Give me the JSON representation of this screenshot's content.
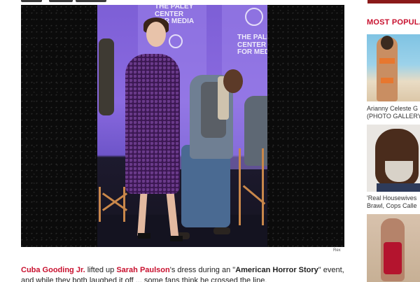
{
  "photo": {
    "credit": "Rex",
    "banner_text_1": "THE PALEY\nCENTER\nFOR MEDIA",
    "banner_text_2": "THE PALEY\nCENTER\nFOR MEDIA"
  },
  "article": {
    "person_1": "Cuba Gooding Jr.",
    "text_1": " lifted up ",
    "person_2": "Sarah Paulson",
    "text_2": "'s dress during an \"",
    "show": "American Horror Story",
    "text_3": "\" event, and while they both laughed it off ... some fans think he crossed the line."
  },
  "sidebar": {
    "heading": "MOST POPULAR",
    "items": [
      {
        "caption_line_1": "Arianny Celeste G",
        "caption_line_2": "(PHOTO GALLERY)"
      },
      {
        "caption_line_1": "'Real Housewives",
        "caption_line_2": "Brawl, Cops Calle"
      },
      {
        "caption_line_1": "",
        "caption_line_2": ""
      }
    ]
  },
  "colors": {
    "accent": "#c8102e",
    "stage_purple": "#7d5fd6"
  }
}
